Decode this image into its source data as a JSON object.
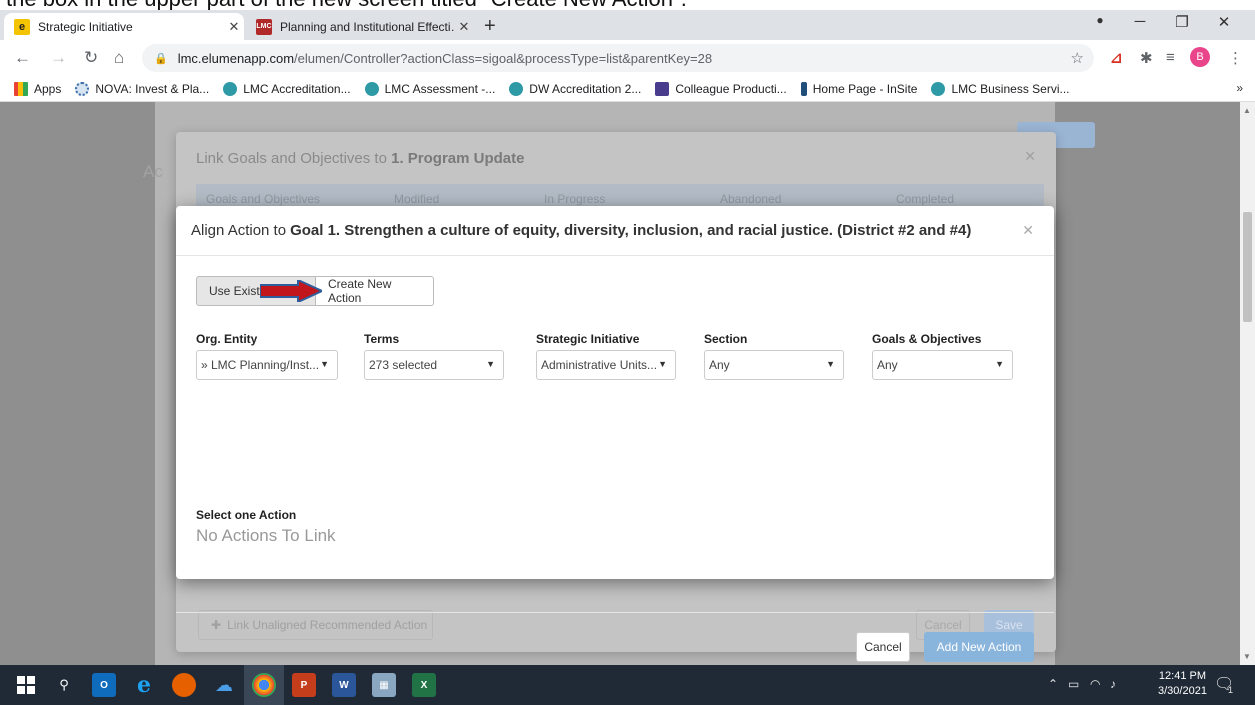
{
  "caption": "the box in the upper part of the new screen titled \"Create New Action\".",
  "browser": {
    "tabs": [
      {
        "title": "Strategic Initiative",
        "active": true
      },
      {
        "title": "Planning and Institutional Effecti…",
        "active": false
      }
    ],
    "url_domain": "lmc.elumenapp.com",
    "url_path": "/elumen/Controller?actionClass=sigoal&processType=list&parentKey=28",
    "profile_initial": "B",
    "bookmarks": [
      "Apps",
      "NOVA: Invest & Pla...",
      "LMC Accreditation...",
      "LMC Assessment -...",
      "DW Accreditation 2...",
      "Colleague Producti...",
      "Home Page - InSite",
      "LMC Business Servi..."
    ]
  },
  "background": {
    "back_modal_title_prefix": "Link Goals and Objectives to",
    "back_modal_title_bold": "1. Program Update",
    "columns": [
      "Goals and Objectives",
      "Modified",
      "In Progress",
      "Abandoned",
      "Completed"
    ],
    "link_button": "Link Unaligned Recommended Action",
    "cancel": "Cancel",
    "save": "Save"
  },
  "modal": {
    "title_prefix": "Align Action to",
    "title_bold": "Goal 1. Strengthen a culture of equity, diversity, inclusion, and racial justice. (District #2 and #4)",
    "toggle_existing": "Use Existin",
    "toggle_new": "Create New Action",
    "filters": [
      {
        "label": "Org. Entity",
        "value": "» LMC Planning/Inst..."
      },
      {
        "label": "Terms",
        "value": "273 selected"
      },
      {
        "label": "Strategic Initiative",
        "value": "Administrative Units..."
      },
      {
        "label": "Section",
        "value": "Any"
      },
      {
        "label": "Goals & Objectives",
        "value": "Any"
      }
    ],
    "select_label": "Select one Action",
    "empty_text": "No Actions To Link",
    "cancel": "Cancel",
    "add": "Add New Action"
  },
  "taskbar": {
    "time": "12:41 PM",
    "date": "3/30/2021",
    "notifications": "1"
  },
  "colors": {
    "accent_blue": "#89b4dc",
    "arrow_red": "#c0161c",
    "arrow_blue": "#2f5e9c"
  }
}
